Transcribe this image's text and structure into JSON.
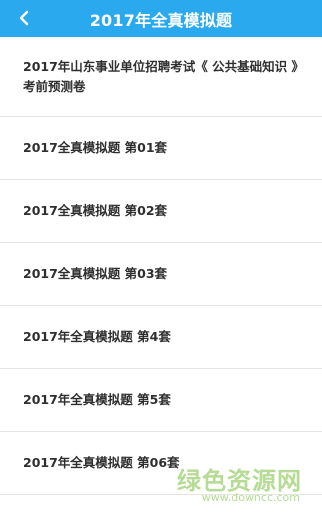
{
  "header": {
    "title": "2017年全真模拟题",
    "back_icon": "chevron-left-icon",
    "background_color": "#2aa9ef"
  },
  "list": {
    "items": [
      {
        "label": "2017年山东事业单位招聘考试《 公共基础知识 》考前预测卷"
      },
      {
        "label": "2017全真模拟题 第01套"
      },
      {
        "label": "2017全真模拟题 第02套"
      },
      {
        "label": "2017全真模拟题 第03套"
      },
      {
        "label": "2017年全真模拟题 第4套"
      },
      {
        "label": "2017年全真模拟题 第5套"
      },
      {
        "label": "2017年全真模拟题 第06套"
      }
    ]
  },
  "watermark": {
    "main_text": "绿色资源网",
    "sub_text": "www.downcc.com"
  }
}
